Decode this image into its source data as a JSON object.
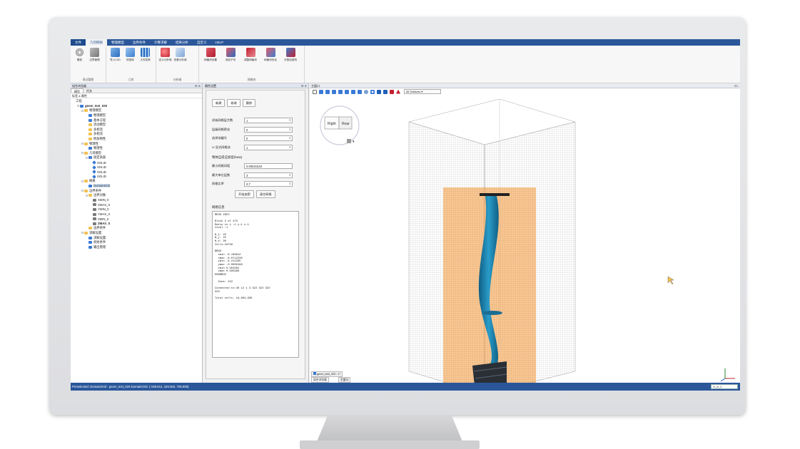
{
  "menu": {
    "items": [
      "文件",
      "几何网格",
      "物理模型",
      "边界条件",
      "计算求解",
      "结果分析",
      "自定义",
      "HELP"
    ]
  },
  "ribbon": {
    "groups": [
      {
        "name": "表达管理",
        "buttons": [
          "模型",
          "边界管理"
        ]
      },
      {
        "name": "几何",
        "buttons": [
          "导入CAD",
          "修型库",
          "几何变换"
        ]
      },
      {
        "name": "分析域",
        "buttons": [
          "定义分析域",
          "查看分析域"
        ]
      },
      {
        "name": "网格块",
        "buttons": [
          "网格块设置",
          "添加子块",
          "调整网格块",
          "网格块优化",
          "分割加密网"
        ]
      }
    ]
  },
  "left_panel": {
    "title": "组合浏览器",
    "tabs": [
      "模型",
      "任务"
    ],
    "subheader": "标签 & 属性",
    "tree": [
      {
        "depth": 0,
        "label": "工程",
        "icon": "none",
        "toggle": ""
      },
      {
        "depth": 1,
        "label": "geom_test_020",
        "icon": "doc",
        "toggle": "⊟",
        "bold": true
      },
      {
        "depth": 2,
        "label": "物理模型",
        "icon": "folder",
        "toggle": "⊟"
      },
      {
        "depth": 3,
        "label": "物理模型",
        "icon": "blue",
        "toggle": ""
      },
      {
        "depth": 3,
        "label": "基本方程",
        "icon": "blue",
        "toggle": ""
      },
      {
        "depth": 3,
        "label": "流动模型",
        "icon": "folder",
        "toggle": ""
      },
      {
        "depth": 3,
        "label": "多相流",
        "icon": "folder",
        "toggle": ""
      },
      {
        "depth": 3,
        "label": "多相流",
        "icon": "folder",
        "toggle": ""
      },
      {
        "depth": 3,
        "label": "附加特性",
        "icon": "folder",
        "toggle": ""
      },
      {
        "depth": 2,
        "label": "物理性",
        "icon": "folder",
        "toggle": "⊟"
      },
      {
        "depth": 3,
        "label": "物理性",
        "icon": "blue",
        "toggle": ""
      },
      {
        "depth": 2,
        "label": "几何模型",
        "icon": "folder",
        "toggle": "⊟"
      },
      {
        "depth": 3,
        "label": "固定表面",
        "icon": "blue",
        "toggle": "⊟"
      },
      {
        "depth": 4,
        "label": "SOLID",
        "icon": "solid",
        "toggle": ""
      },
      {
        "depth": 4,
        "label": "SOLID",
        "icon": "solid",
        "toggle": ""
      },
      {
        "depth": 4,
        "label": "SOLID",
        "icon": "solid",
        "toggle": ""
      },
      {
        "depth": 4,
        "label": "SOLID",
        "icon": "solid",
        "toggle": ""
      },
      {
        "depth": 2,
        "label": "网格",
        "icon": "folder",
        "toggle": "⊟"
      },
      {
        "depth": 3,
        "label": "DomainGrid",
        "icon": "blue",
        "toggle": "",
        "selected": true
      },
      {
        "depth": 2,
        "label": "边界条件",
        "icon": "folder",
        "toggle": "⊟"
      },
      {
        "depth": 3,
        "label": "边界对象",
        "icon": "folder",
        "toggle": "⊟"
      },
      {
        "depth": 4,
        "label": "XMIN_0",
        "icon": "mesh",
        "toggle": ""
      },
      {
        "depth": 4,
        "label": "XMAX_0",
        "icon": "mesh",
        "toggle": ""
      },
      {
        "depth": 4,
        "label": "YMIN_0",
        "icon": "mesh",
        "toggle": ""
      },
      {
        "depth": 4,
        "label": "YMAX_0",
        "icon": "mesh",
        "toggle": ""
      },
      {
        "depth": 4,
        "label": "ZMIN_0",
        "icon": "mesh",
        "toggle": ""
      },
      {
        "depth": 4,
        "label": "ZMAX_0",
        "icon": "mesh",
        "toggle": "",
        "bold": true
      },
      {
        "depth": 3,
        "label": "边界条件",
        "icon": "folder",
        "toggle": ""
      },
      {
        "depth": 2,
        "label": "求解设置",
        "icon": "folder",
        "toggle": "⊟"
      },
      {
        "depth": 3,
        "label": "求解设置",
        "icon": "blue",
        "toggle": ""
      },
      {
        "depth": 3,
        "label": "初始条件",
        "icon": "blue",
        "toggle": ""
      },
      {
        "depth": 3,
        "label": "输出管理",
        "icon": "blue",
        "toggle": ""
      }
    ]
  },
  "mid_panel": {
    "title": "属性设置",
    "buttons": [
      "新建",
      "修改",
      "删除"
    ],
    "fields": [
      {
        "label": "初始网格层大数",
        "value": "1"
      },
      {
        "label": "层级网格密化",
        "value": "0"
      },
      {
        "label": "选择块编号",
        "value": "0"
      },
      {
        "label": "显式网格块",
        "value": "1",
        "check": true
      }
    ],
    "section": "物体自适应加密(beta)",
    "adapt_fields": [
      {
        "label": "最小网格间距",
        "value": "0.00021519"
      },
      {
        "label": "最大单位层数",
        "value": "3"
      },
      {
        "label": "网格比率",
        "value": "0.7"
      }
    ],
    "adapt_buttons": [
      "开始加密",
      "清空网格"
    ],
    "output_label": "网格信息",
    "output_text": "MESH INFO\n\nBlock 2 of 473\nRatio in x :1 y:1 z:1\nLevel :1\n\nN_i: 25\nN_j: 25\nN_k: 30\nCells:18750\n\nBBOX\n  xmin -0.189612\n  xmax -0.0712236\n  ymin -0.212335\n  ymax -0.0609198\n  zmin 0.504362\n  zmax 0.595998\nENDBBOX\n\n  Zone: 322\n\nConnected to:40 12 1 3 322 322 322\n323\n\nTotal cells: 16,904,936"
  },
  "viewport": {
    "title": "主窗口",
    "display_mode": "All Surfaces",
    "navcube": {
      "right": "Right",
      "rear": "Rear"
    }
  },
  "bottom_tabs": [
    "geom_test_020 : 1*",
    "组合浏览器",
    "主窗口"
  ],
  "status": {
    "text": "Preselected: DomainGrid - geom_test_020.DomainGrid. (-189.612, 184.502, 705.805)",
    "box": "N_m_C"
  },
  "colors": {
    "menu_bg": "#2b579a",
    "blade": "#1e7fa8",
    "domain": "#f39a3f"
  }
}
